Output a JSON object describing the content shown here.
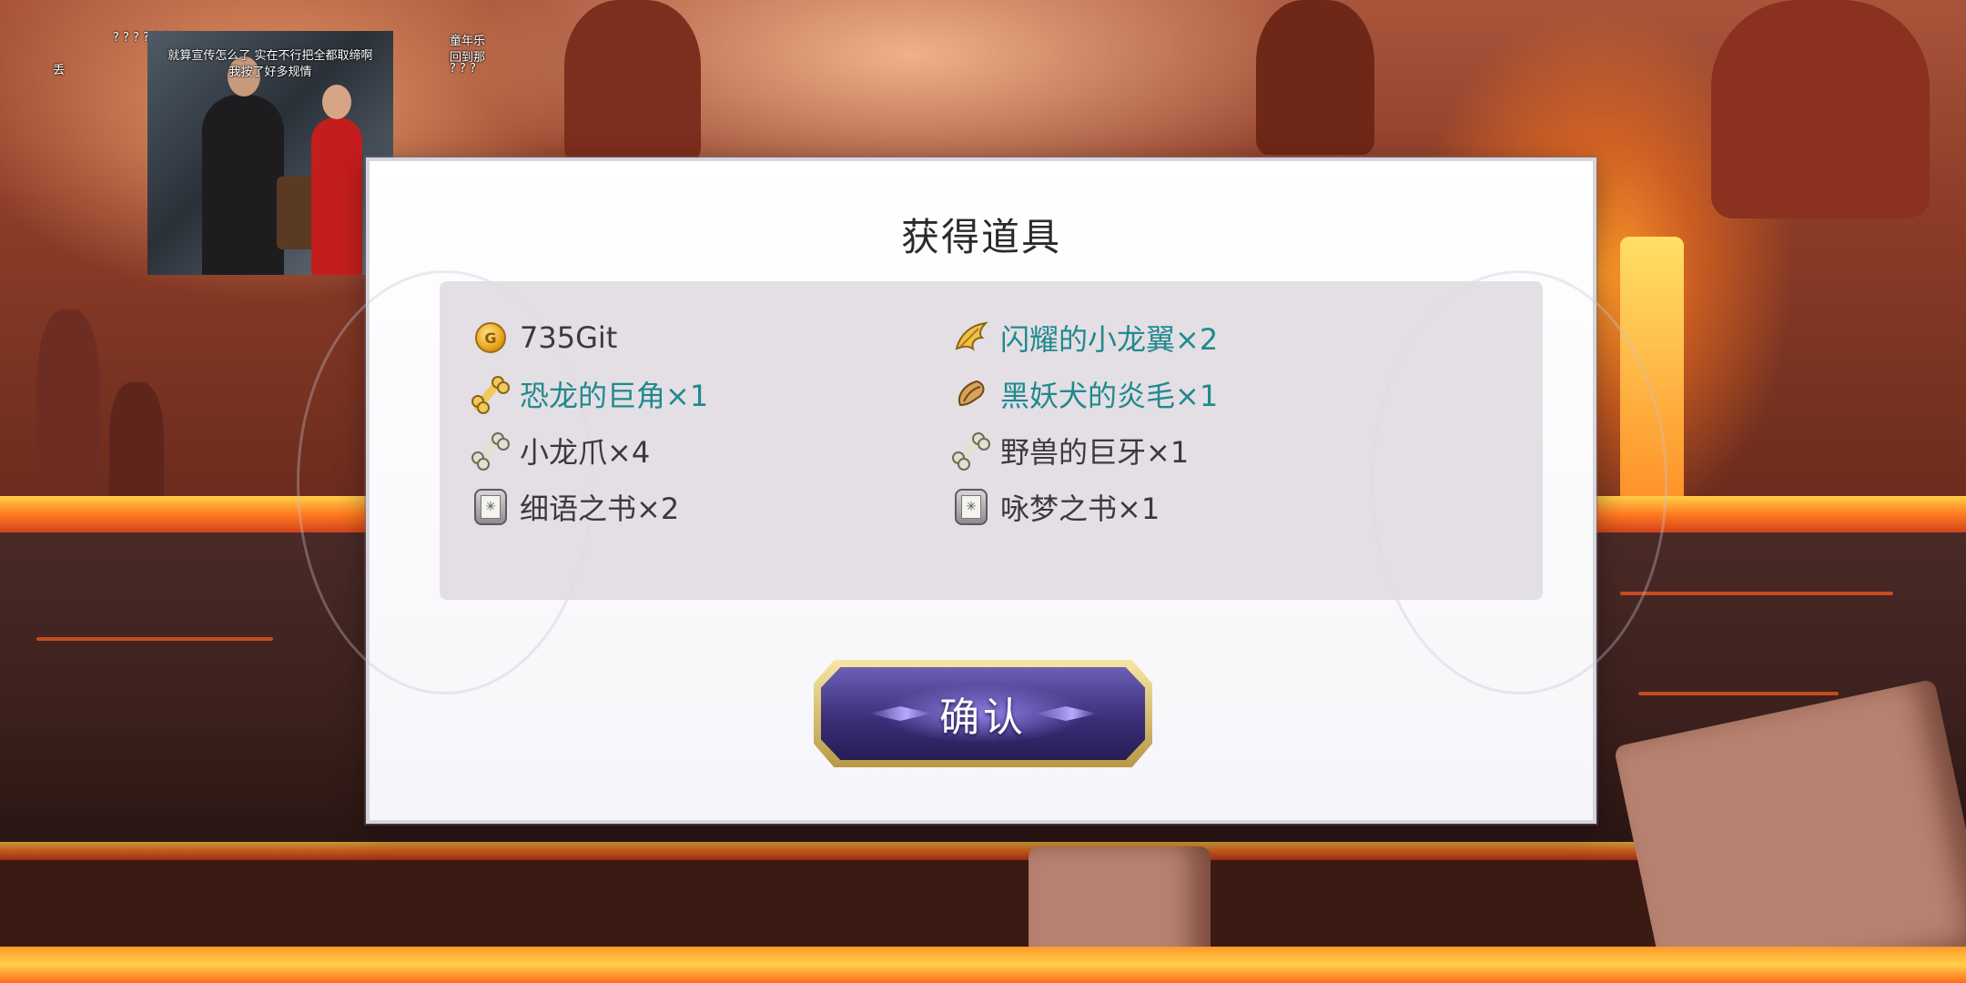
{
  "dialog": {
    "title": "获得道具",
    "items": [
      {
        "label": "735Git",
        "icon": "gold-coin-icon",
        "color": "#3a3a3a"
      },
      {
        "label": "闪耀的小龙翼×2",
        "icon": "dragon-wing-icon",
        "color": "#1f8a8d"
      },
      {
        "label": "恐龙的巨角×1",
        "icon": "bone-horn-icon",
        "color": "#1f8a8d"
      },
      {
        "label": "黑妖犬的炎毛×1",
        "icon": "fur-scroll-icon",
        "color": "#1f8a8d"
      },
      {
        "label": "小龙爪×4",
        "icon": "bone-claw-icon",
        "color": "#3a3a3a"
      },
      {
        "label": "野兽的巨牙×1",
        "icon": "bone-fang-icon",
        "color": "#3a3a3a"
      },
      {
        "label": "细语之书×2",
        "icon": "book-icon",
        "color": "#3a3a3a"
      },
      {
        "label": "咏梦之书×1",
        "icon": "book-icon",
        "color": "#3a3a3a"
      }
    ],
    "confirm_label": "确认"
  },
  "video_overlay": {
    "subtitle_line1": "就算宣传怎么了   实在不行把全都取缔啊",
    "subtitle_line2": "我按了好多规情",
    "danmaku_left": "? ? ? ? ? ? ?",
    "danmaku_right1": "童年乐",
    "danmaku_right2": "回到那",
    "danmaku_right3": "? ? ?",
    "danmaku_edge": "丢"
  }
}
